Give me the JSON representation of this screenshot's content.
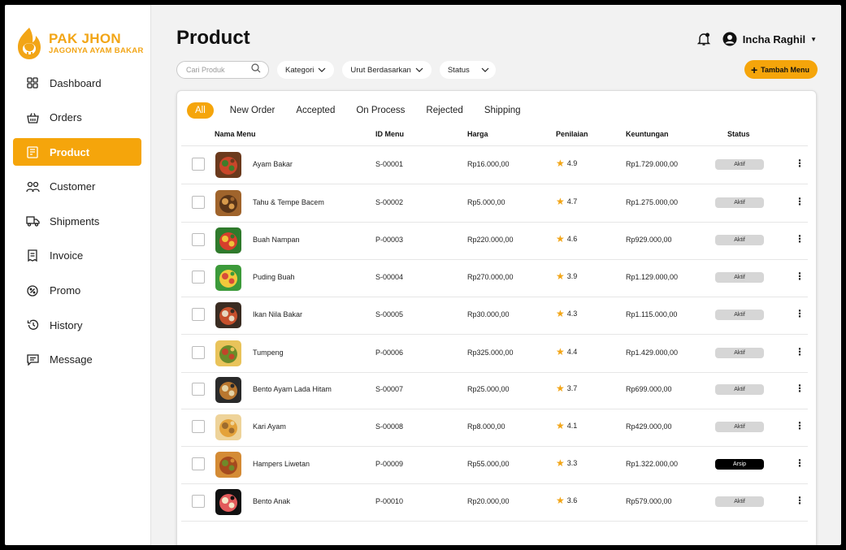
{
  "brand": {
    "name": "PAK JHON",
    "tagline": "JAGONYA AYAM BAKAR",
    "color": "#f2a516"
  },
  "sidebar": {
    "items": [
      {
        "label": "Dashboard",
        "icon": "grid-icon",
        "active": false
      },
      {
        "label": "Orders",
        "icon": "basket-icon",
        "active": false
      },
      {
        "label": "Product",
        "icon": "box-icon",
        "active": true
      },
      {
        "label": "Customer",
        "icon": "users-icon",
        "active": false
      },
      {
        "label": "Shipments",
        "icon": "truck-icon",
        "active": false
      },
      {
        "label": "Invoice",
        "icon": "receipt-icon",
        "active": false
      },
      {
        "label": "Promo",
        "icon": "discount-icon",
        "active": false
      },
      {
        "label": "History",
        "icon": "history-icon",
        "active": false
      },
      {
        "label": "Message",
        "icon": "message-icon",
        "active": false
      }
    ]
  },
  "header": {
    "title": "Product",
    "user_name": "Incha Raghil"
  },
  "filters": {
    "search_placeholder": "Cari Produk",
    "category": "Kategori",
    "sort": "Urut Berdasarkan",
    "status": "Status"
  },
  "add_button": {
    "label": "Tambah Menu"
  },
  "tabs": [
    "All",
    "New Order",
    "Accepted",
    "On Process",
    "Rejected",
    "Shipping"
  ],
  "table": {
    "headers": {
      "name": "Nama  Menu",
      "id": "ID Menu",
      "price": "Harga",
      "rating": "Penilaian",
      "profit": "Keuntungan",
      "status": "Status"
    },
    "rows": [
      {
        "name": "Ayam Bakar",
        "id": "S-00001",
        "price": "Rp16.000,00",
        "rating": "4.9",
        "profit": "Rp1.729.000,00",
        "status": "Aktif"
      },
      {
        "name": "Tahu & Tempe Bacem",
        "id": "S-00002",
        "price": "Rp5.000,00",
        "rating": "4.7",
        "profit": "Rp1.275.000,00",
        "status": "Aktif"
      },
      {
        "name": "Buah Nampan",
        "id": "P-00003",
        "price": "Rp220.000,00",
        "rating": "4.6",
        "profit": "Rp929.000,00",
        "status": "Aktif"
      },
      {
        "name": "Puding Buah",
        "id": "S-00004",
        "price": "Rp270.000,00",
        "rating": "3.9",
        "profit": "Rp1.129.000,00",
        "status": "Aktif"
      },
      {
        "name": "Ikan Nila Bakar",
        "id": "S-00005",
        "price": "Rp30.000,00",
        "rating": "4.3",
        "profit": "Rp1.115.000,00",
        "status": "Aktif"
      },
      {
        "name": "Tumpeng",
        "id": "P-00006",
        "price": "Rp325.000,00",
        "rating": "4.4",
        "profit": "Rp1.429.000,00",
        "status": "Aktif"
      },
      {
        "name": "Bento Ayam Lada Hitam",
        "id": "S-00007",
        "price": "Rp25.000,00",
        "rating": "3.7",
        "profit": "Rp699.000,00",
        "status": "Aktif"
      },
      {
        "name": "Kari Ayam",
        "id": "S-00008",
        "price": "Rp8.000,00",
        "rating": "4.1",
        "profit": "Rp429.000,00",
        "status": "Aktif"
      },
      {
        "name": "Hampers Liwetan",
        "id": "P-00009",
        "price": "Rp55.000,00",
        "rating": "3.3",
        "profit": "Rp1.322.000,00",
        "status": "Arsip"
      },
      {
        "name": "Bento Anak",
        "id": "P-00010",
        "price": "Rp20.000,00",
        "rating": "3.6",
        "profit": "Rp579.000,00",
        "status": "Aktif"
      }
    ]
  }
}
